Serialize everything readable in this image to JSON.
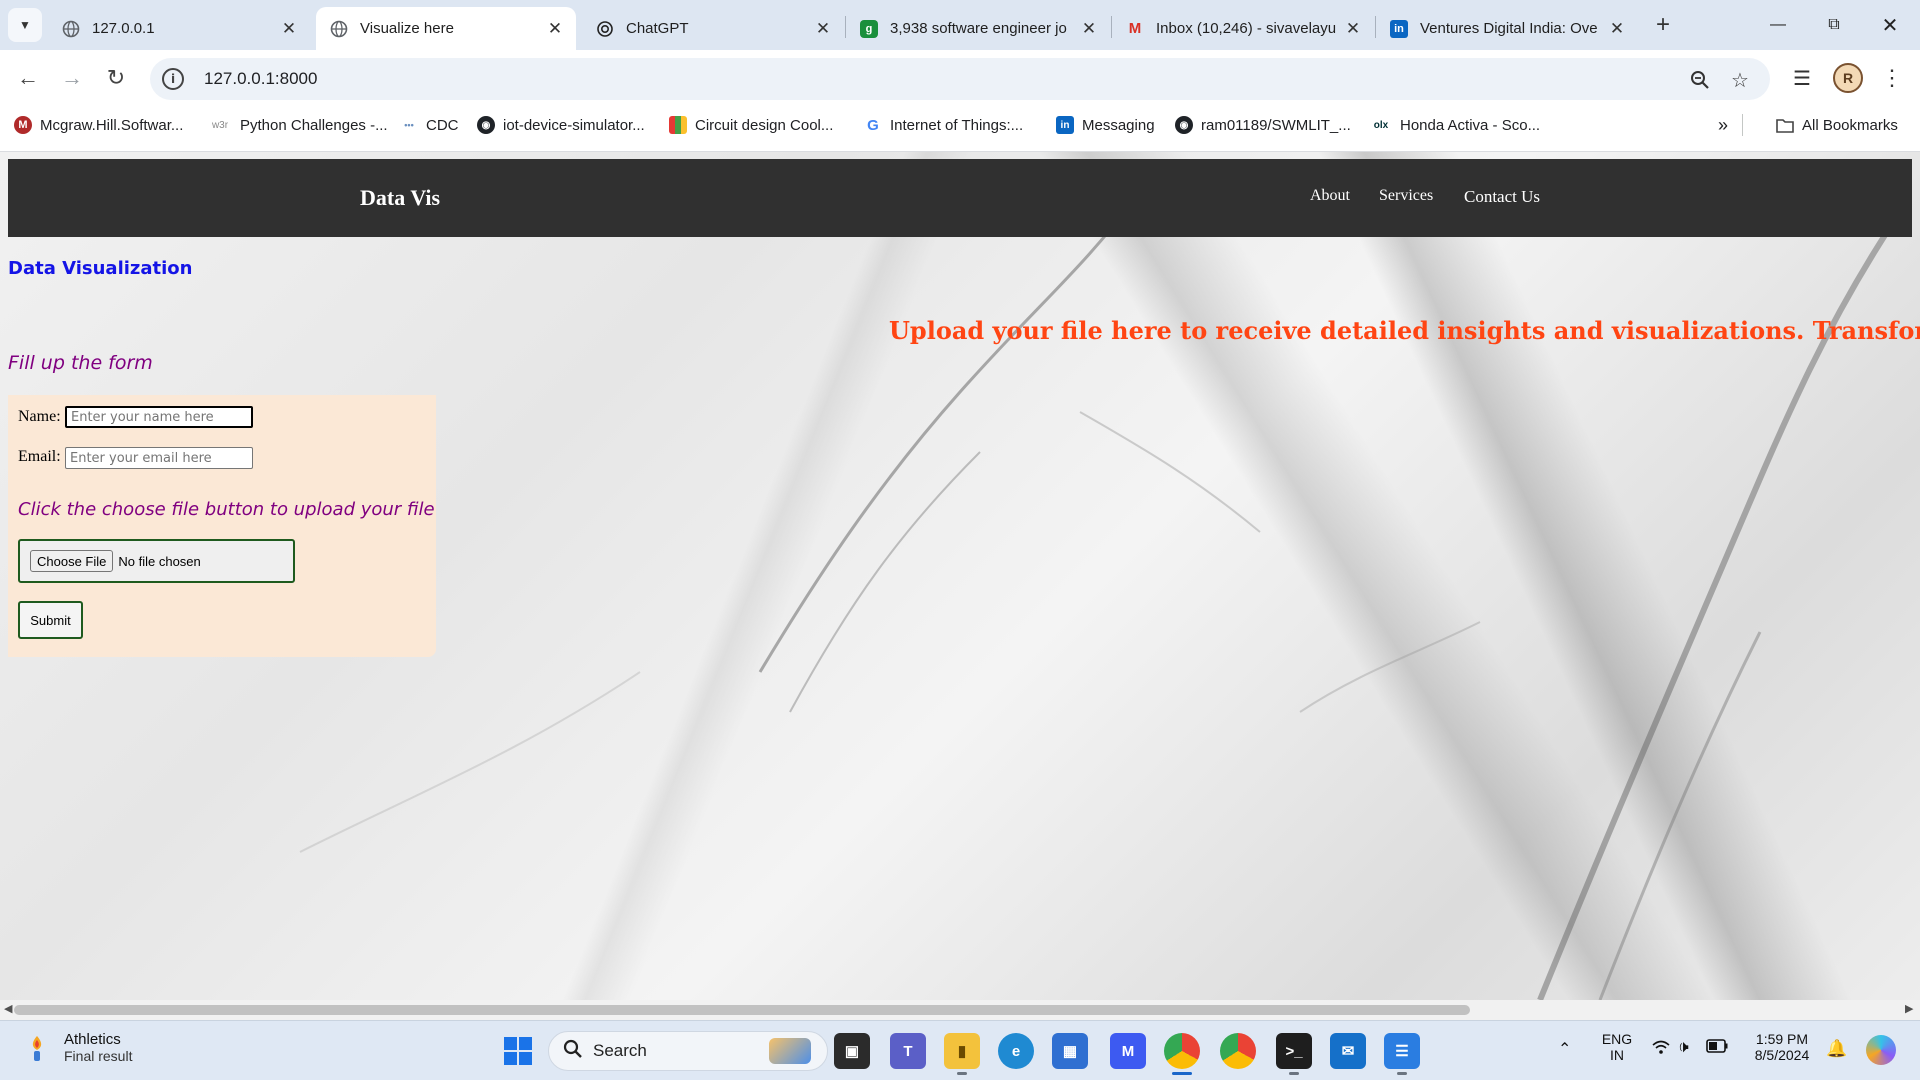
{
  "browser": {
    "tabs": [
      {
        "title": "127.0.0.1",
        "active": false
      },
      {
        "title": "Visualize here",
        "active": true
      },
      {
        "title": "ChatGPT",
        "active": false
      },
      {
        "title": "3,938 software engineer jo",
        "active": false
      },
      {
        "title": "Inbox (10,246) - sivavelayu",
        "active": false
      },
      {
        "title": "Ventures Digital India: Ove",
        "active": false
      }
    ],
    "url": "127.0.0.1:8000",
    "bookmarks": [
      "Mcgraw.Hill.Softwar...",
      "Python Challenges -...",
      "CDC",
      "iot-device-simulator...",
      "Circuit design Cool...",
      "Internet of Things:...",
      "Messaging",
      "ram01189/SWMLIT_...",
      "Honda Activa - Sco..."
    ],
    "bookmark_icons": [
      "w3r"
    ],
    "all_bookmarks": "All Bookmarks",
    "avatar_letter": "R"
  },
  "site": {
    "brand": "Data Vis",
    "nav": [
      "About",
      "Services",
      "Contact Us"
    ],
    "page_heading": "Data Visualization",
    "marquee": "Upload your file here to receive detailed insights and visualizations. Transform your",
    "form_heading": "Fill up the form",
    "form": {
      "name_label": "Name:",
      "name_placeholder": "Enter your name here",
      "email_label": "Email:",
      "email_placeholder": "Enter your email here",
      "upload_hint": "Click the choose file button to upload your file",
      "choose_file": "Choose File",
      "no_file": "No file chosen",
      "submit": "Submit"
    },
    "colors": {
      "nav_bg": "#303030",
      "heading_blue": "#1414e6",
      "marquee_orange": "#ff4513",
      "purple": "#800080",
      "form_bg": "#fbe8d6"
    }
  },
  "taskbar": {
    "weather_title": "Athletics",
    "weather_sub": "Final result",
    "search": "Search",
    "lang_top": "ENG",
    "lang_bottom": "IN",
    "time": "1:59 PM",
    "date": "8/5/2024"
  }
}
